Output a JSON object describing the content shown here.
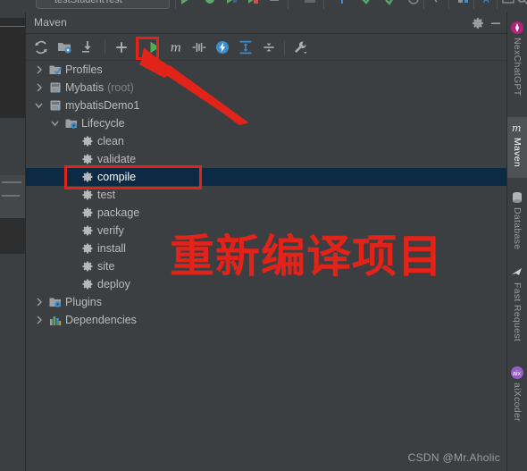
{
  "window": {
    "title": "Maven",
    "gear_icon": "gear-icon",
    "minimize_icon": "minimize-icon"
  },
  "top_strip": {
    "run_configuration": "testStudentTest",
    "icons": [
      "run-icon",
      "debug-icon",
      "coverage-icon",
      "profile-icon",
      "stop-icon",
      "build-icon",
      "search-everywhere-icon",
      "git-update-icon",
      "git-commit-icon",
      "git-push-icon",
      "history-icon",
      "structure-icon",
      "translate-icon",
      "terminal-icon",
      "search-icon"
    ]
  },
  "toolbar": {
    "items": [
      {
        "name": "reload-all-maven-projects",
        "icon": "refresh-icon",
        "label": "Reload All Maven Projects"
      },
      {
        "name": "add-maven-project",
        "icon": "add-folder-icon",
        "label": "Add Maven Projects"
      },
      {
        "name": "download-sources",
        "icon": "download-icon",
        "label": "Download Sources and/or Documentation"
      },
      {
        "name": "add-run-configuration",
        "icon": "plus-icon",
        "label": "Add"
      },
      {
        "name": "run-maven-build",
        "icon": "green-play-icon",
        "label": "Run Maven Build"
      },
      {
        "name": "execute-maven-goal",
        "icon": "maven-m-icon",
        "label": "Execute Maven Goal"
      },
      {
        "name": "toggle-skip-tests",
        "icon": "skip-tests-icon",
        "label": "Toggle 'Skip Tests' Mode"
      },
      {
        "name": "toggle-offline-mode",
        "icon": "offline-lightning-icon",
        "label": "Toggle Offline Mode"
      },
      {
        "name": "expand-all",
        "icon": "expand-all-icon",
        "label": "Expand All"
      },
      {
        "name": "collapse-all",
        "icon": "collapse-all-icon",
        "label": "Collapse All"
      },
      {
        "name": "maven-settings",
        "icon": "wrench-icon",
        "label": "Maven Settings"
      }
    ]
  },
  "tree": {
    "rows": [
      {
        "label": "Profiles",
        "suffix": "",
        "indent": 0,
        "arrow": "collapsed",
        "icon": "profiles-folder-icon",
        "selected": false
      },
      {
        "label": "Mybatis",
        "suffix": "(root)",
        "indent": 0,
        "arrow": "collapsed",
        "icon": "maven-project-icon",
        "selected": false
      },
      {
        "label": "mybatisDemo1",
        "suffix": "",
        "indent": 0,
        "arrow": "expanded",
        "icon": "maven-project-icon",
        "selected": false
      },
      {
        "label": "Lifecycle",
        "suffix": "",
        "indent": 1,
        "arrow": "expanded",
        "icon": "lifecycle-folder-icon",
        "selected": false
      },
      {
        "label": "clean",
        "suffix": "",
        "indent": 2,
        "arrow": "none",
        "icon": "maven-goal-icon",
        "selected": false
      },
      {
        "label": "validate",
        "suffix": "",
        "indent": 2,
        "arrow": "none",
        "icon": "maven-goal-icon",
        "selected": false
      },
      {
        "label": "compile",
        "suffix": "",
        "indent": 2,
        "arrow": "none",
        "icon": "maven-goal-icon",
        "selected": true
      },
      {
        "label": "test",
        "suffix": "",
        "indent": 2,
        "arrow": "none",
        "icon": "maven-goal-icon",
        "selected": false
      },
      {
        "label": "package",
        "suffix": "",
        "indent": 2,
        "arrow": "none",
        "icon": "maven-goal-icon",
        "selected": false
      },
      {
        "label": "verify",
        "suffix": "",
        "indent": 2,
        "arrow": "none",
        "icon": "maven-goal-icon",
        "selected": false
      },
      {
        "label": "install",
        "suffix": "",
        "indent": 2,
        "arrow": "none",
        "icon": "maven-goal-icon",
        "selected": false
      },
      {
        "label": "site",
        "suffix": "",
        "indent": 2,
        "arrow": "none",
        "icon": "maven-goal-icon",
        "selected": false
      },
      {
        "label": "deploy",
        "suffix": "",
        "indent": 2,
        "arrow": "none",
        "icon": "maven-goal-icon",
        "selected": false
      },
      {
        "label": "Plugins",
        "suffix": "",
        "indent": 0,
        "arrow": "collapsed",
        "icon": "plugins-folder-icon",
        "selected": false
      },
      {
        "label": "Dependencies",
        "suffix": "",
        "indent": 0,
        "arrow": "collapsed",
        "icon": "dependencies-icon",
        "selected": false
      }
    ]
  },
  "right_sidebar": {
    "tabs": [
      {
        "label": "NexChatGPT",
        "icon": "nexchatgpt-icon",
        "active": false
      },
      {
        "label": "Maven",
        "icon": "maven-m-icon",
        "active": true
      },
      {
        "label": "Database",
        "icon": "database-icon",
        "active": false
      },
      {
        "label": "Fast Request",
        "icon": "fast-request-icon",
        "active": false
      },
      {
        "label": "aiXcoder",
        "icon": "aixcoder-icon",
        "active": false
      }
    ]
  },
  "annotations": {
    "highlight_color": "#e2231a",
    "callout_text": "重新编译项目",
    "run_button_box_label": "run-maven-build-highlight",
    "compile_box_label": "compile-goal-highlight",
    "arrow_label": "pointer-arrow"
  },
  "watermark": {
    "text": "CSDN @Mr.Aholic"
  }
}
